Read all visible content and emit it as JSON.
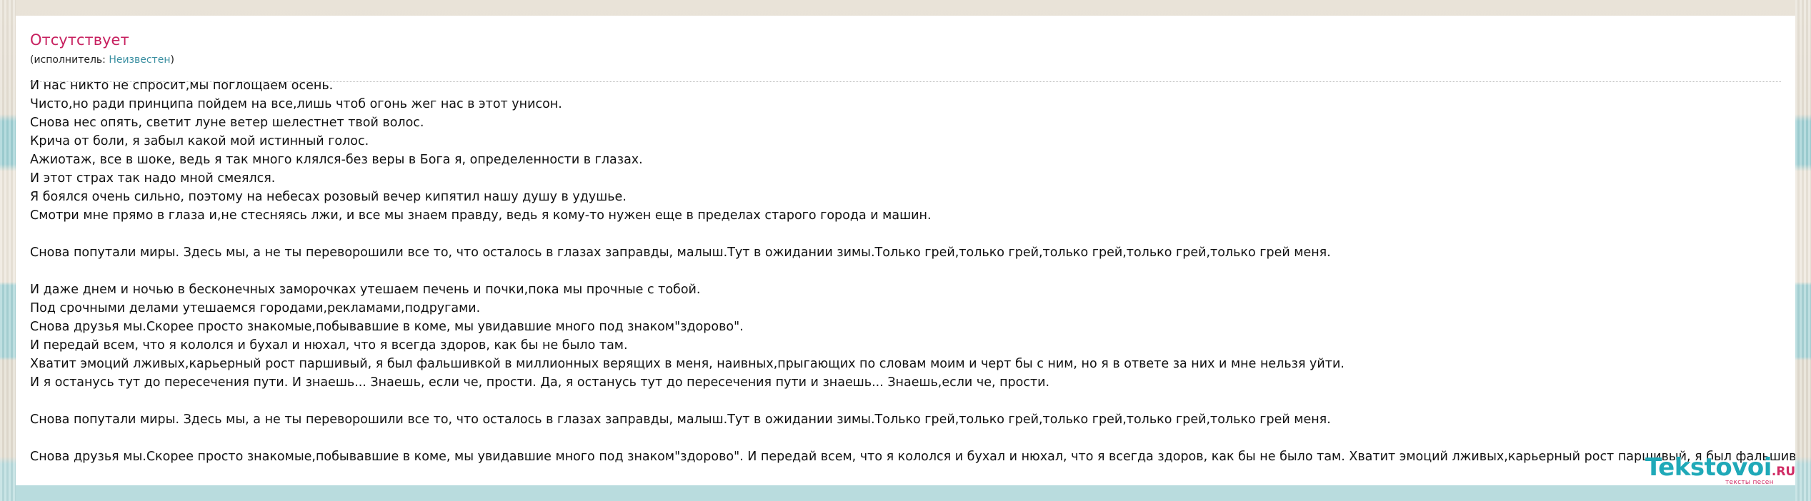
{
  "song": {
    "title": "Отсутствует",
    "performer_prefix": "(исполнитель: ",
    "performer_name": "Неизвестен",
    "performer_suffix": ")"
  },
  "lyrics": [
    "И нас никто не спросит,мы поглощаем осень.",
    "Чисто,но ради принципа пойдем на все,лишь чтоб огонь жег нас в этот унисон.",
    "Снова нес опять, светит луне ветер шелестнет твой волос.",
    "Крича от боли, я забыл какой мой истинный голос.",
    "Ажиотаж, все в шоке, ведь я так много клялся-без веры в Бога я, определенности в глазах.",
    "И этот страх так надо мной смеялся.",
    "Я боялся очень сильно, поэтому на небесах розовый вечер кипятил нашу душу в удушье.",
    "Смотри мне прямо в глаза и,не стесняясь лжи, и все мы знаем правду, ведь я кому-то нужен еще в пределах старого города и машин.",
    "",
    "Снова попутали миры. Здесь мы, а не ты переворошили все то, что осталось в глазах заправды, малыш.Тут в ожидании зимы.Только грей,только грей,только грей,только грей,только грей меня.",
    "",
    "И даже днем и ночью в бесконечных заморочках утешаем печень и почки,пока мы прочные с тобой.",
    "Под срочными делами утешаемся городами,рекламами,подругами.",
    "Снова друзья мы.Скорее просто знакомые,побывавшие в коме, мы увидавшие много под знаком\"здорово\".",
    "И передай всем, что я кололся и бухал и нюхал, что я всегда здоров, как бы не было там.",
    "Хватит эмоций лживых,карьерный рост паршивый, я был фальшивкой в миллионных верящих в меня, наивных,прыгающих по словам моим и черт бы с ним, но я в ответе за них и мне нельзя уйти.",
    "И я останусь тут до пересечения пути. И знаешь... Знаешь, если че, прости. Да, я останусь тут до пересечения пути и знаешь... Знаешь,если че, прости.",
    "",
    "Снова попутали миры. Здесь мы, а не ты переворошили все то, что осталось в глазах заправды, малыш.Тут в ожидании зимы.Только грей,только грей,только грей,только грей,только грей меня.",
    "",
    "Снова друзья мы.Скорее просто знакомые,побывавшие в коме, мы увидавшие много под знаком\"здорово\". И передай всем, что я кололся и бухал и нюхал, что я всегда здоров, как бы не было там. Хватит эмоций лживых,карьерный рост паршивый, я был фальшив"
  ],
  "watermark": {
    "brand": "Tekstovoi",
    "tld": ".RU",
    "tagline": "тексты песен"
  },
  "colors": {
    "title": "#c7205f",
    "link": "#3a8fa1",
    "brand": "#1fa9b8",
    "brand_accent": "#d02b64"
  }
}
